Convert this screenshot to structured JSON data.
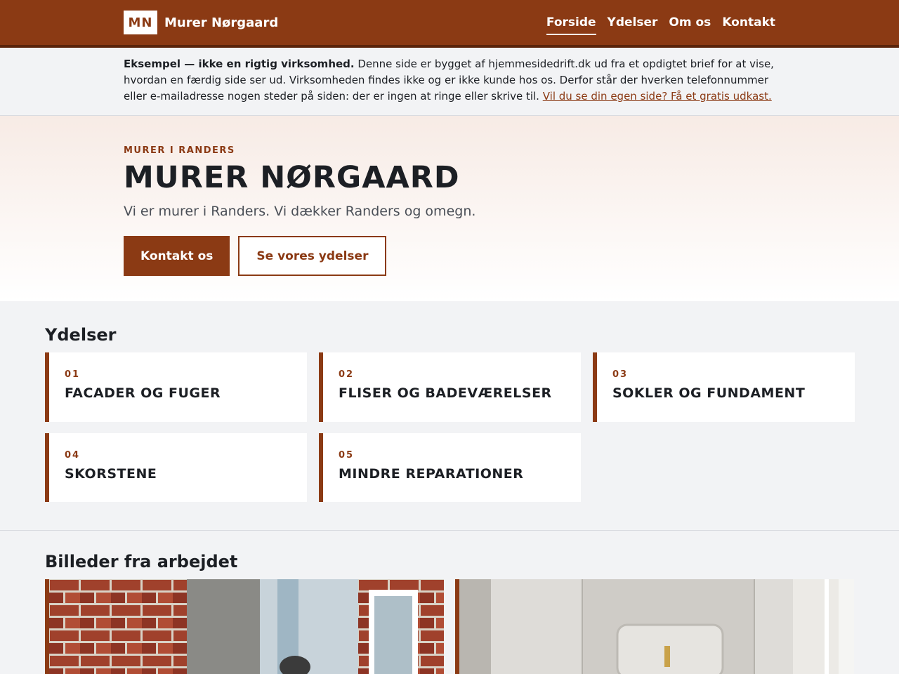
{
  "header": {
    "logo_mark": "MN",
    "brand_name": "Murer Nørgaard",
    "nav": [
      {
        "label": "Forside",
        "active": true
      },
      {
        "label": "Ydelser",
        "active": false
      },
      {
        "label": "Om os",
        "active": false
      },
      {
        "label": "Kontakt",
        "active": false
      }
    ]
  },
  "notice": {
    "bold": "Eksempel — ikke en rigtig virksomhed.",
    "text": " Denne side er bygget af hjemmesidedrift.dk ud fra et opdigtet brief for at vise, hvordan en færdig side ser ud. Virksomheden findes ikke og er ikke kunde hos os. Derfor står der hverken telefonnummer eller e-mailadresse nogen steder på siden: der er ingen at ringe eller skrive til. ",
    "link": "Vil du se din egen side? Få et gratis udkast."
  },
  "hero": {
    "eyebrow": "MURER I RANDERS",
    "title": "MURER NØRGAARD",
    "subtitle": "Vi er murer i Randers. Vi dækker Randers og omegn.",
    "primary_button": "Kontakt os",
    "secondary_button": "Se vores ydelser"
  },
  "services": {
    "title": "Ydelser",
    "items": [
      {
        "num": "01",
        "title": "FACADER OG FUGER"
      },
      {
        "num": "02",
        "title": "FLISER OG BADEVÆRELSER"
      },
      {
        "num": "03",
        "title": "SOKLER OG FUNDAMENT"
      },
      {
        "num": "04",
        "title": "SKORSTENE"
      },
      {
        "num": "05",
        "title": "MINDRE REPARATIONER"
      }
    ]
  },
  "gallery": {
    "title": "Billeder fra arbejdet"
  },
  "colors": {
    "brand": "#8b3a14",
    "brand_dark": "#5a240b",
    "text": "#1c1f24",
    "muted": "#4a4f57",
    "background": "#f2f3f5"
  }
}
